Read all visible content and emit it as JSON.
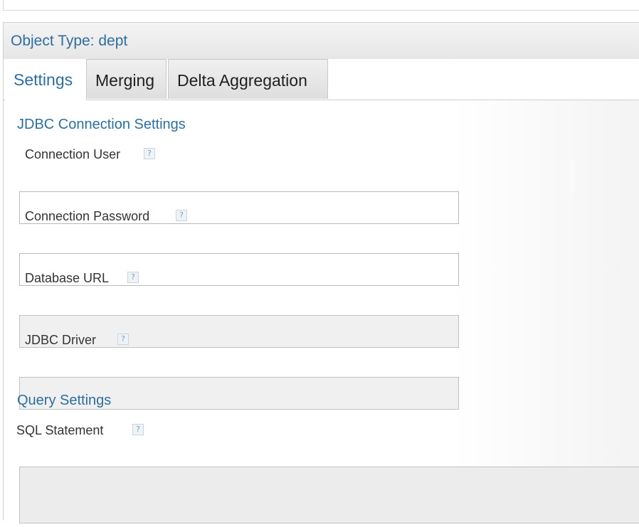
{
  "object_header": {
    "title": "Object Type: dept"
  },
  "tabs": [
    {
      "label": "Settings",
      "active": true
    },
    {
      "label": "Merging",
      "active": false
    },
    {
      "label": "Delta Aggregation",
      "active": false
    }
  ],
  "form": {
    "jdbc_section_title": "JDBC Connection Settings",
    "fields": [
      {
        "label": "Connection User",
        "value": "",
        "disabled": false
      },
      {
        "label": "Connection Password",
        "value": "",
        "disabled": false
      },
      {
        "label": "Database URL",
        "value": "",
        "disabled": true
      },
      {
        "label": "JDBC Driver",
        "value": "",
        "disabled": true
      }
    ],
    "query_section_title": "Query Settings",
    "sql_statement": {
      "label": "SQL Statement",
      "value": ""
    },
    "help_symbol": "?"
  },
  "colors": {
    "accent": "#2e6e9e",
    "tab_inactive_bg": "#e6e6e6",
    "input_border": "#b9b9b9",
    "disabled_bg": "#f0f0f0"
  }
}
